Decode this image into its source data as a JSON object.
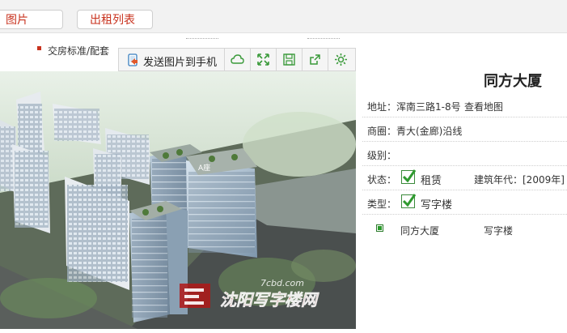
{
  "tabs": [
    {
      "label": "图片"
    },
    {
      "label": "出租列表"
    }
  ],
  "subnav": {
    "item": "交房标准/配套"
  },
  "toolbar": {
    "send_label": "发送图片到手机",
    "buttons": [
      "cloud-icon",
      "fullscreen-icon",
      "save-icon",
      "share-icon",
      "settings-icon"
    ],
    "accent": "#3a9a3a"
  },
  "photo": {
    "watermark_top": "7cbd.com",
    "watermark_main": "沈阳写字楼网",
    "label_small": "A座"
  },
  "building": {
    "name": "同方大厦",
    "address_label": "地址：",
    "address": "浑南三路1-8号",
    "map_link": "查看地图",
    "district_label": "商圈：",
    "district": "青大(金廊)沿线",
    "grade_label": "级别：",
    "grade": "",
    "status_label": "状态：",
    "status": "租赁",
    "year_label": "建筑年代：",
    "year": "[2009年]",
    "type_label": "类型：",
    "type": "写字楼",
    "list_name": "同方大厦",
    "list_type": "写字楼"
  }
}
